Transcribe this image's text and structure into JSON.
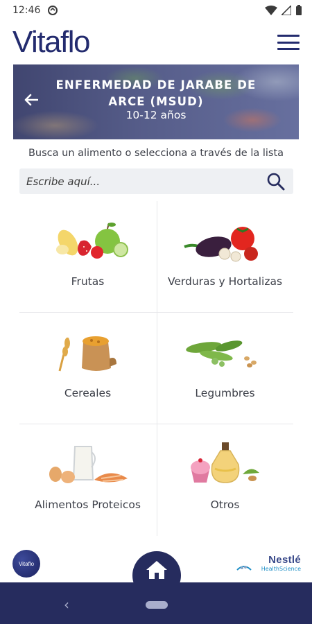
{
  "status": {
    "time": "12:46"
  },
  "header": {
    "logo": "Vitaflo"
  },
  "banner": {
    "title": "ENFERMEDAD DE JARABE DE ARCE (MSUD)",
    "subtitle": "10-12 años"
  },
  "search": {
    "hint": "Busca un alimento o selecciona a través de la lista",
    "placeholder": "Escribe aquí..."
  },
  "categories": [
    {
      "label": "Frutas",
      "icon": "fruits-icon"
    },
    {
      "label": "Verduras y Hortalizas",
      "icon": "vegetables-icon"
    },
    {
      "label": "Cereales",
      "icon": "cereals-icon"
    },
    {
      "label": "Legumbres",
      "icon": "legumes-icon"
    },
    {
      "label": "Alimentos Proteicos",
      "icon": "protein-foods-icon"
    },
    {
      "label": "Otros",
      "icon": "others-icon"
    }
  ],
  "footer": {
    "badge": "Vitaflo",
    "brand": "Nestlé",
    "brand_sub": "HealthScience"
  },
  "colors": {
    "brand_navy": "#262c5e",
    "logo_navy": "#232b6e",
    "search_bg": "#eef0f3"
  }
}
